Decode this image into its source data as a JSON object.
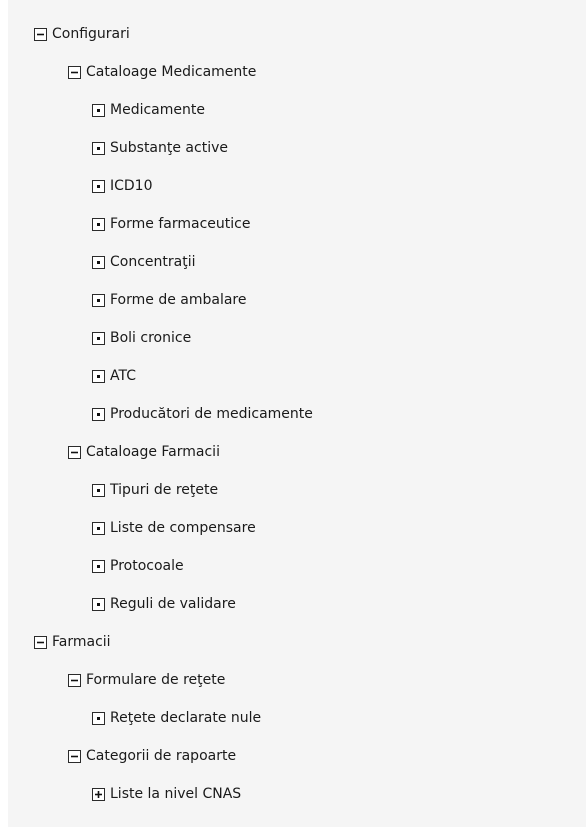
{
  "tree": {
    "nodes": [
      {
        "label": "Configurari",
        "state": "expanded",
        "icon": "collapse-icon"
      },
      {
        "label": "Cataloage Medicamente",
        "state": "expanded",
        "icon": "collapse-icon"
      },
      {
        "label": "Medicamente",
        "state": "leaf",
        "icon": "leaf-icon"
      },
      {
        "label": "Substanţe active",
        "state": "leaf",
        "icon": "leaf-icon"
      },
      {
        "label": "ICD10",
        "state": "leaf",
        "icon": "leaf-icon"
      },
      {
        "label": "Forme farmaceutice",
        "state": "leaf",
        "icon": "leaf-icon"
      },
      {
        "label": "Concentraţii",
        "state": "leaf",
        "icon": "leaf-icon"
      },
      {
        "label": "Forme de ambalare",
        "state": "leaf",
        "icon": "leaf-icon"
      },
      {
        "label": "Boli cronice",
        "state": "leaf",
        "icon": "leaf-icon"
      },
      {
        "label": "ATC",
        "state": "leaf",
        "icon": "leaf-icon"
      },
      {
        "label": "Producători de medicamente",
        "state": "leaf",
        "icon": "leaf-icon"
      },
      {
        "label": "Cataloage Farmacii",
        "state": "expanded",
        "icon": "collapse-icon"
      },
      {
        "label": "Tipuri de reţete",
        "state": "leaf",
        "icon": "leaf-icon"
      },
      {
        "label": "Liste de compensare",
        "state": "leaf",
        "icon": "leaf-icon"
      },
      {
        "label": "Protocoale",
        "state": "leaf",
        "icon": "leaf-icon"
      },
      {
        "label": "Reguli de validare",
        "state": "leaf",
        "icon": "leaf-icon"
      },
      {
        "label": "Farmacii",
        "state": "expanded",
        "icon": "collapse-icon"
      },
      {
        "label": "Formulare de reţete",
        "state": "expanded",
        "icon": "collapse-icon"
      },
      {
        "label": "Reţete declarate nule",
        "state": "leaf",
        "icon": "leaf-icon"
      },
      {
        "label": "Categorii de rapoarte",
        "state": "expanded",
        "icon": "collapse-icon"
      },
      {
        "label": "Liste la nivel CNAS",
        "state": "collapsed",
        "icon": "expand-icon"
      }
    ]
  }
}
